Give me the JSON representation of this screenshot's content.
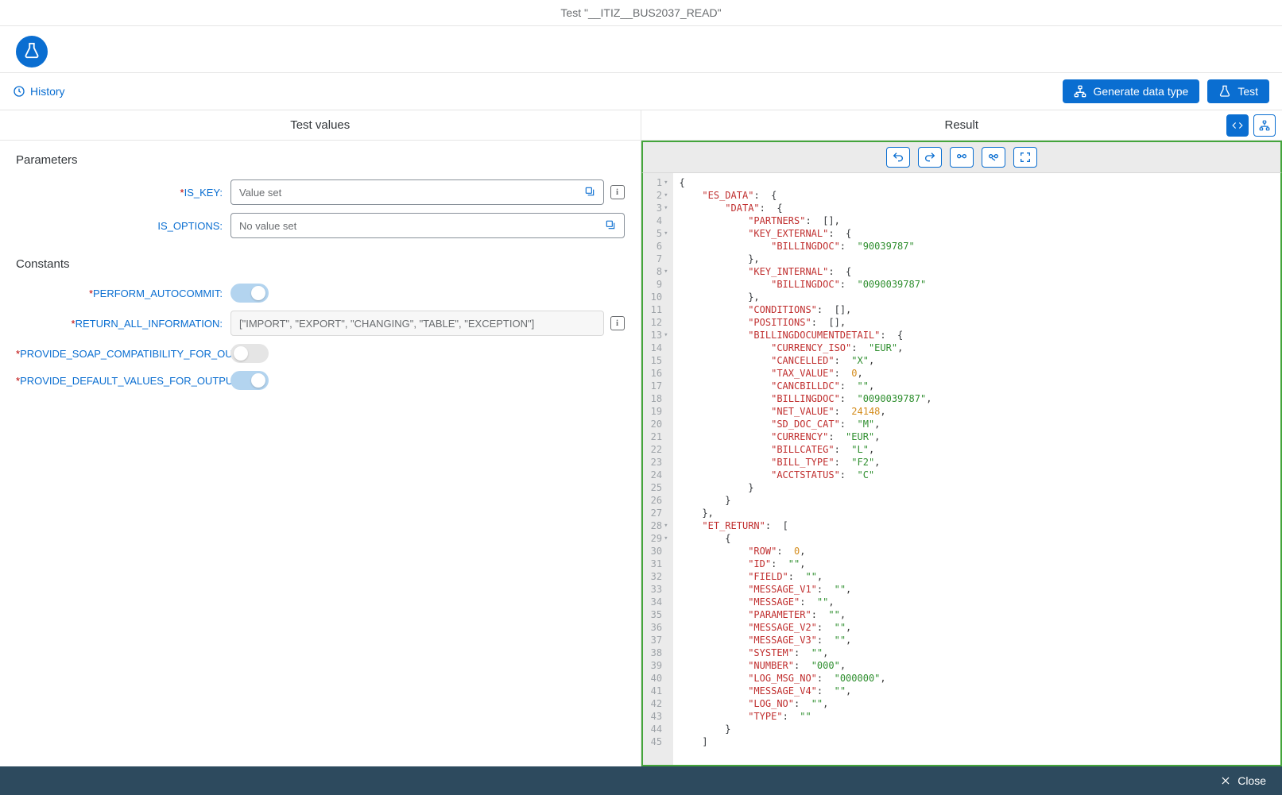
{
  "title": "Test \"__ITIZ__BUS2037_READ\"",
  "toolbar": {
    "history": "History",
    "generate": "Generate data type",
    "test": "Test"
  },
  "panels": {
    "left_title": "Test values",
    "right_title": "Result"
  },
  "sections": {
    "parameters": "Parameters",
    "constants": "Constants"
  },
  "params": {
    "is_key": {
      "label": "IS_KEY:",
      "value": "Value set",
      "required": true
    },
    "is_options": {
      "label": "IS_OPTIONS:",
      "value": "No value set",
      "required": false
    }
  },
  "constants": {
    "perform_autocommit": {
      "label": "PERFORM_AUTOCOMMIT:",
      "on": true
    },
    "return_all_information": {
      "label": "RETURN_ALL_INFORMATION:",
      "value": "[\"IMPORT\", \"EXPORT\", \"CHANGING\", \"TABLE\", \"EXCEPTION\"]"
    },
    "provide_soap": {
      "label": "PROVIDE_SOAP_COMPATIBILITY_FOR_OU...",
      "on": false
    },
    "provide_default": {
      "label": "PROVIDE_DEFAULT_VALUES_FOR_OUTPUT:",
      "on": true
    }
  },
  "result_json": {
    "ES_DATA": {
      "DATA": {
        "PARTNERS": [],
        "KEY_EXTERNAL": {
          "BILLINGDOC": "90039787"
        },
        "KEY_INTERNAL": {
          "BILLINGDOC": "0090039787"
        },
        "CONDITIONS": [],
        "POSITIONS": [],
        "BILLINGDOCUMENTDETAIL": {
          "CURRENCY_ISO": "EUR",
          "CANCELLED": "X",
          "TAX_VALUE": 0,
          "CANCBILLDC": "",
          "BILLINGDOC": "0090039787",
          "NET_VALUE": 24148,
          "SD_DOC_CAT": "M",
          "CURRENCY": "EUR",
          "BILLCATEG": "L",
          "BILL_TYPE": "F2",
          "ACCTSTATUS": "C"
        }
      }
    },
    "ET_RETURN": [
      {
        "ROW": 0,
        "ID": "",
        "FIELD": "",
        "MESSAGE_V1": "",
        "MESSAGE": "",
        "PARAMETER": "",
        "MESSAGE_V2": "",
        "MESSAGE_V3": "",
        "SYSTEM": "",
        "NUMBER": "000",
        "LOG_MSG_NO": "000000",
        "MESSAGE_V4": "",
        "LOG_NO": "",
        "TYPE": ""
      }
    ]
  },
  "code_lines": [
    {
      "n": 1,
      "fold": true,
      "html": "{"
    },
    {
      "n": 2,
      "fold": true,
      "html": "    <span class='tok-key'>\"ES_DATA\"</span><span class='tok-punct'>:</span>  {"
    },
    {
      "n": 3,
      "fold": true,
      "html": "        <span class='tok-key'>\"DATA\"</span><span class='tok-punct'>:</span>  {"
    },
    {
      "n": 4,
      "html": "            <span class='tok-key'>\"PARTNERS\"</span><span class='tok-punct'>:</span>  []<span class='tok-punct'>,</span>"
    },
    {
      "n": 5,
      "fold": true,
      "html": "            <span class='tok-key'>\"KEY_EXTERNAL\"</span><span class='tok-punct'>:</span>  {"
    },
    {
      "n": 6,
      "html": "                <span class='tok-key'>\"BILLINGDOC\"</span><span class='tok-punct'>:</span>  <span class='tok-str'>\"90039787\"</span>"
    },
    {
      "n": 7,
      "html": "            }<span class='tok-punct'>,</span>"
    },
    {
      "n": 8,
      "fold": true,
      "html": "            <span class='tok-key'>\"KEY_INTERNAL\"</span><span class='tok-punct'>:</span>  {"
    },
    {
      "n": 9,
      "html": "                <span class='tok-key'>\"BILLINGDOC\"</span><span class='tok-punct'>:</span>  <span class='tok-str'>\"0090039787\"</span>"
    },
    {
      "n": 10,
      "html": "            }<span class='tok-punct'>,</span>"
    },
    {
      "n": 11,
      "html": "            <span class='tok-key'>\"CONDITIONS\"</span><span class='tok-punct'>:</span>  []<span class='tok-punct'>,</span>"
    },
    {
      "n": 12,
      "html": "            <span class='tok-key'>\"POSITIONS\"</span><span class='tok-punct'>:</span>  []<span class='tok-punct'>,</span>"
    },
    {
      "n": 13,
      "fold": true,
      "html": "            <span class='tok-key'>\"BILLINGDOCUMENTDETAIL\"</span><span class='tok-punct'>:</span>  {"
    },
    {
      "n": 14,
      "html": "                <span class='tok-key'>\"CURRENCY_ISO\"</span><span class='tok-punct'>:</span>  <span class='tok-str'>\"EUR\"</span><span class='tok-punct'>,</span>"
    },
    {
      "n": 15,
      "html": "                <span class='tok-key'>\"CANCELLED\"</span><span class='tok-punct'>:</span>  <span class='tok-str'>\"X\"</span><span class='tok-punct'>,</span>"
    },
    {
      "n": 16,
      "html": "                <span class='tok-key'>\"TAX_VALUE\"</span><span class='tok-punct'>:</span>  <span class='tok-num'>0</span><span class='tok-punct'>,</span>"
    },
    {
      "n": 17,
      "html": "                <span class='tok-key'>\"CANCBILLDC\"</span><span class='tok-punct'>:</span>  <span class='tok-str'>\"\"</span><span class='tok-punct'>,</span>"
    },
    {
      "n": 18,
      "html": "                <span class='tok-key'>\"BILLINGDOC\"</span><span class='tok-punct'>:</span>  <span class='tok-str'>\"0090039787\"</span><span class='tok-punct'>,</span>"
    },
    {
      "n": 19,
      "html": "                <span class='tok-key'>\"NET_VALUE\"</span><span class='tok-punct'>:</span>  <span class='tok-num'>24148</span><span class='tok-punct'>,</span>"
    },
    {
      "n": 20,
      "html": "                <span class='tok-key'>\"SD_DOC_CAT\"</span><span class='tok-punct'>:</span>  <span class='tok-str'>\"M\"</span><span class='tok-punct'>,</span>"
    },
    {
      "n": 21,
      "html": "                <span class='tok-key'>\"CURRENCY\"</span><span class='tok-punct'>:</span>  <span class='tok-str'>\"EUR\"</span><span class='tok-punct'>,</span>"
    },
    {
      "n": 22,
      "html": "                <span class='tok-key'>\"BILLCATEG\"</span><span class='tok-punct'>:</span>  <span class='tok-str'>\"L\"</span><span class='tok-punct'>,</span>"
    },
    {
      "n": 23,
      "html": "                <span class='tok-key'>\"BILL_TYPE\"</span><span class='tok-punct'>:</span>  <span class='tok-str'>\"F2\"</span><span class='tok-punct'>,</span>"
    },
    {
      "n": 24,
      "html": "                <span class='tok-key'>\"ACCTSTATUS\"</span><span class='tok-punct'>:</span>  <span class='tok-str'>\"C\"</span>"
    },
    {
      "n": 25,
      "html": "            }"
    },
    {
      "n": 26,
      "html": "        }"
    },
    {
      "n": 27,
      "html": "    }<span class='tok-punct'>,</span>"
    },
    {
      "n": 28,
      "fold": true,
      "html": "    <span class='tok-key'>\"ET_RETURN\"</span><span class='tok-punct'>:</span>  ["
    },
    {
      "n": 29,
      "fold": true,
      "html": "        {"
    },
    {
      "n": 30,
      "html": "            <span class='tok-key'>\"ROW\"</span><span class='tok-punct'>:</span>  <span class='tok-num'>0</span><span class='tok-punct'>,</span>"
    },
    {
      "n": 31,
      "html": "            <span class='tok-key'>\"ID\"</span><span class='tok-punct'>:</span>  <span class='tok-str'>\"\"</span><span class='tok-punct'>,</span>"
    },
    {
      "n": 32,
      "html": "            <span class='tok-key'>\"FIELD\"</span><span class='tok-punct'>:</span>  <span class='tok-str'>\"\"</span><span class='tok-punct'>,</span>"
    },
    {
      "n": 33,
      "html": "            <span class='tok-key'>\"MESSAGE_V1\"</span><span class='tok-punct'>:</span>  <span class='tok-str'>\"\"</span><span class='tok-punct'>,</span>"
    },
    {
      "n": 34,
      "html": "            <span class='tok-key'>\"MESSAGE\"</span><span class='tok-punct'>:</span>  <span class='tok-str'>\"\"</span><span class='tok-punct'>,</span>"
    },
    {
      "n": 35,
      "html": "            <span class='tok-key'>\"PARAMETER\"</span><span class='tok-punct'>:</span>  <span class='tok-str'>\"\"</span><span class='tok-punct'>,</span>"
    },
    {
      "n": 36,
      "html": "            <span class='tok-key'>\"MESSAGE_V2\"</span><span class='tok-punct'>:</span>  <span class='tok-str'>\"\"</span><span class='tok-punct'>,</span>"
    },
    {
      "n": 37,
      "html": "            <span class='tok-key'>\"MESSAGE_V3\"</span><span class='tok-punct'>:</span>  <span class='tok-str'>\"\"</span><span class='tok-punct'>,</span>"
    },
    {
      "n": 38,
      "html": "            <span class='tok-key'>\"SYSTEM\"</span><span class='tok-punct'>:</span>  <span class='tok-str'>\"\"</span><span class='tok-punct'>,</span>"
    },
    {
      "n": 39,
      "html": "            <span class='tok-key'>\"NUMBER\"</span><span class='tok-punct'>:</span>  <span class='tok-str'>\"000\"</span><span class='tok-punct'>,</span>"
    },
    {
      "n": 40,
      "html": "            <span class='tok-key'>\"LOG_MSG_NO\"</span><span class='tok-punct'>:</span>  <span class='tok-str'>\"000000\"</span><span class='tok-punct'>,</span>"
    },
    {
      "n": 41,
      "html": "            <span class='tok-key'>\"MESSAGE_V4\"</span><span class='tok-punct'>:</span>  <span class='tok-str'>\"\"</span><span class='tok-punct'>,</span>"
    },
    {
      "n": 42,
      "html": "            <span class='tok-key'>\"LOG_NO\"</span><span class='tok-punct'>:</span>  <span class='tok-str'>\"\"</span><span class='tok-punct'>,</span>"
    },
    {
      "n": 43,
      "html": "            <span class='tok-key'>\"TYPE\"</span><span class='tok-punct'>:</span>  <span class='tok-str'>\"\"</span>"
    },
    {
      "n": 44,
      "html": "        }"
    },
    {
      "n": 45,
      "html": "    ]"
    }
  ],
  "footer": {
    "close": "Close"
  }
}
